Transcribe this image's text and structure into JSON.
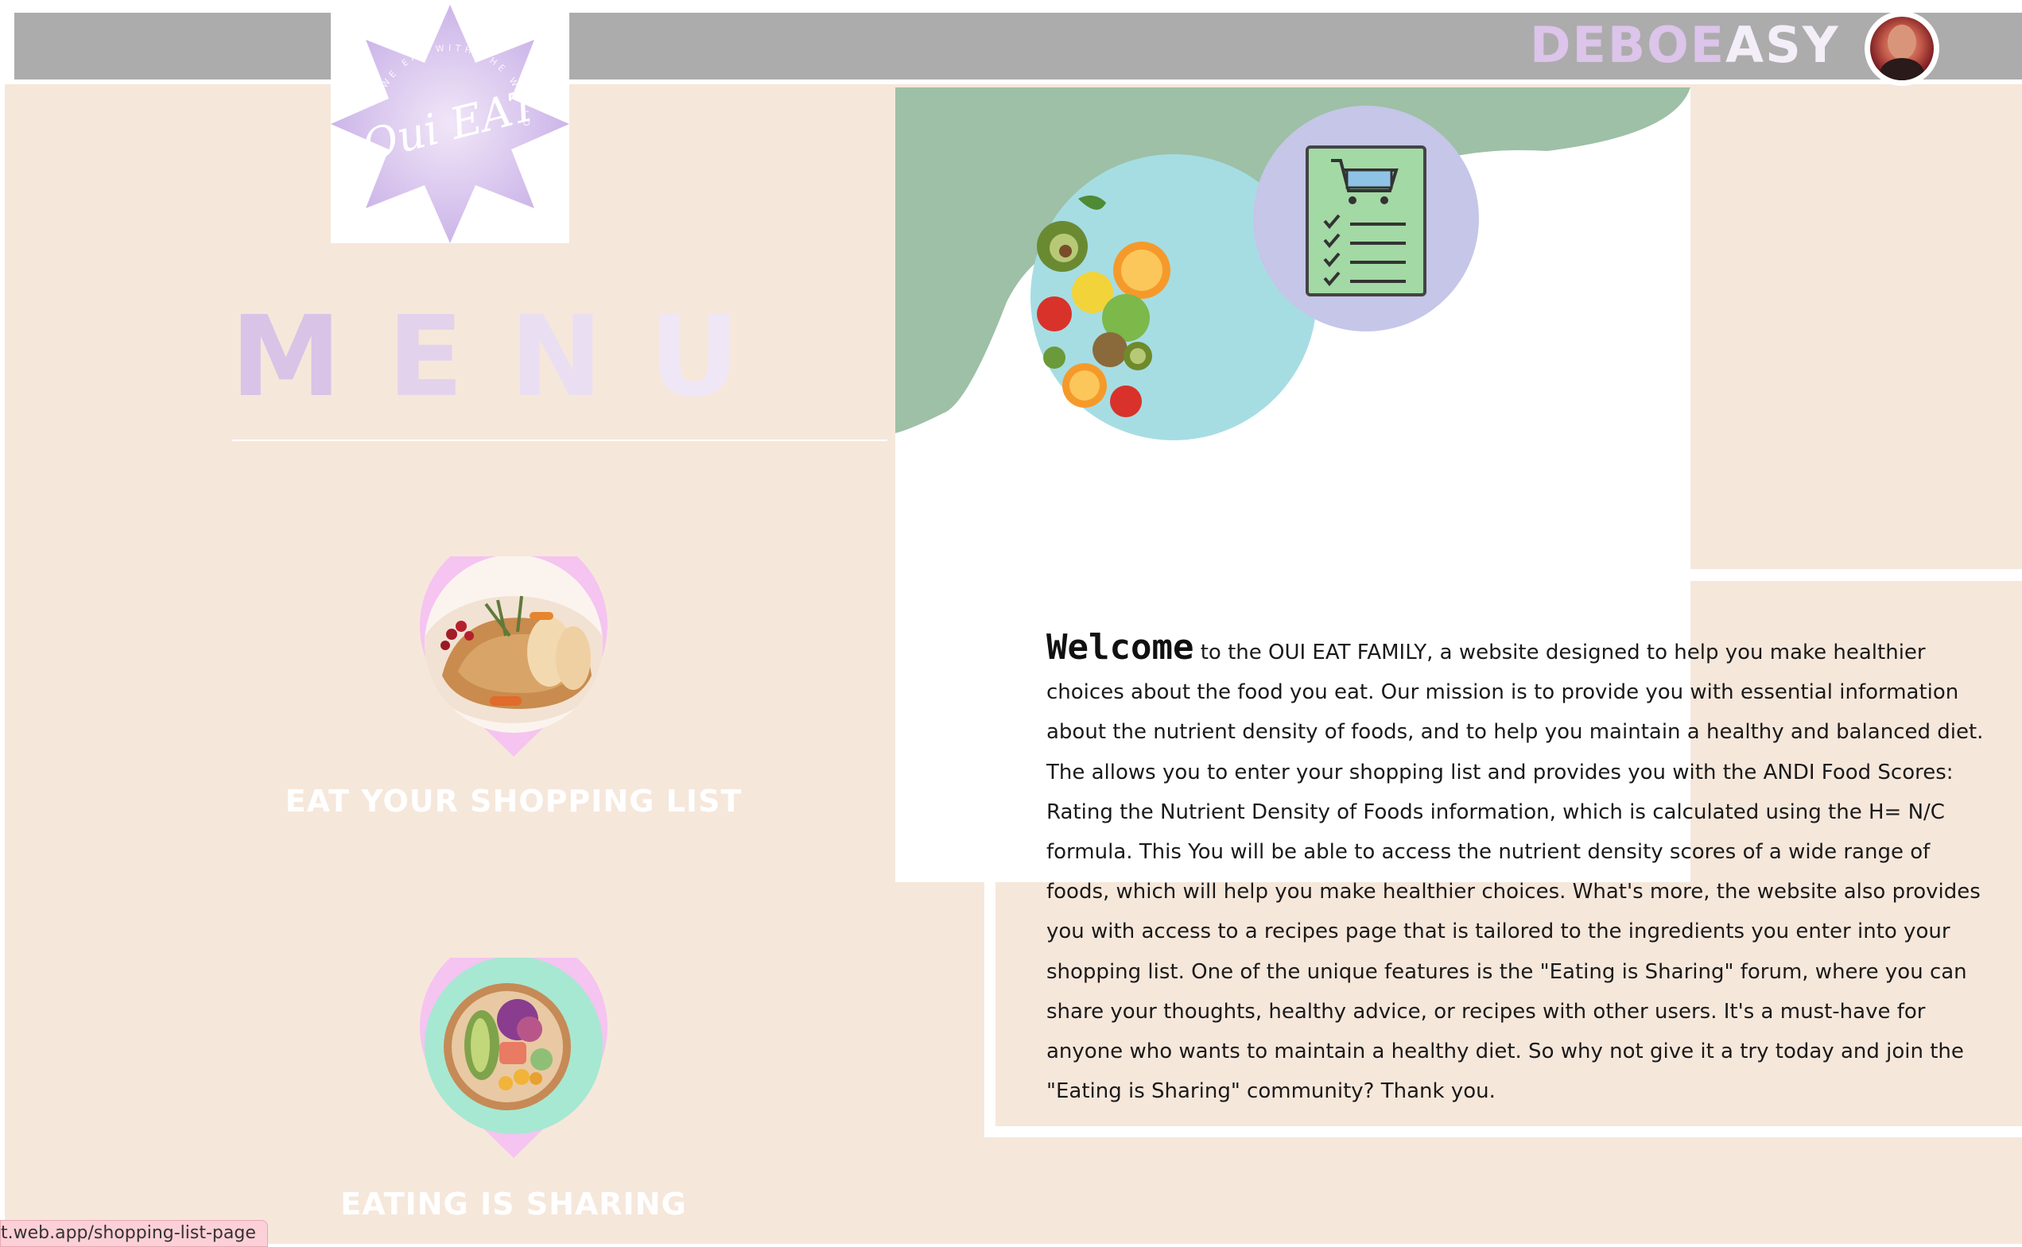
{
  "header": {
    "username_part1": "DEBOE",
    "username_part2": "ASY",
    "avatar_icon": "user-avatar-icon",
    "bar_color": "#acacac"
  },
  "logo": {
    "script_text": "Oui EAT",
    "ring_text": "WE EAT WITH THE WORLD"
  },
  "menu": {
    "heading_letters": [
      "M",
      "E",
      "N",
      "U"
    ],
    "items": [
      {
        "label": "EAT YOUR SHOPPING LIST",
        "image": "roast-chicken-food-icon"
      },
      {
        "label": "EATING IS SHARING",
        "image": "salad-bowl-food-icon"
      }
    ]
  },
  "hero": {
    "fruit_plate_icon": "fruit-plate-icon",
    "shopping_list_icon": "shopping-list-cart-icon"
  },
  "about": {
    "welcome": "Welcome",
    "body": " to the OUI EAT FAMILY, a website designed to help you make healthier choices about the food you eat. Our mission is to provide you with essential information about the nutrient density of foods, and to help you maintain a healthy and balanced diet. The allows you to enter your shopping list and provides you with the ANDI Food Scores: Rating the Nutrient Density of Foods information, which is calculated using the H= N/C formula. This You will be able to access the nutrient density scores of a wide range of foods, which will help you make healthier choices. What's more, the website also provides you with access to a recipes page that is tailored to the ingredients you enter into your shopping list. One of the unique features is the \"Eating is Sharing\" forum, where you can share your thoughts, healthy advice, or recipes with other users. It's a must-have for anyone who wants to maintain a healthy diet. So why not give it a try today and join the \"Eating is Sharing\" community? Thank you."
  },
  "status_bar": {
    "url": "t.web.app/shopping-list-page"
  },
  "colors": {
    "page_bg": "#f6e7db",
    "lavender": "#d4bde6",
    "sage": "#9dc0a6",
    "pink_ring": "#f5c4f0"
  }
}
